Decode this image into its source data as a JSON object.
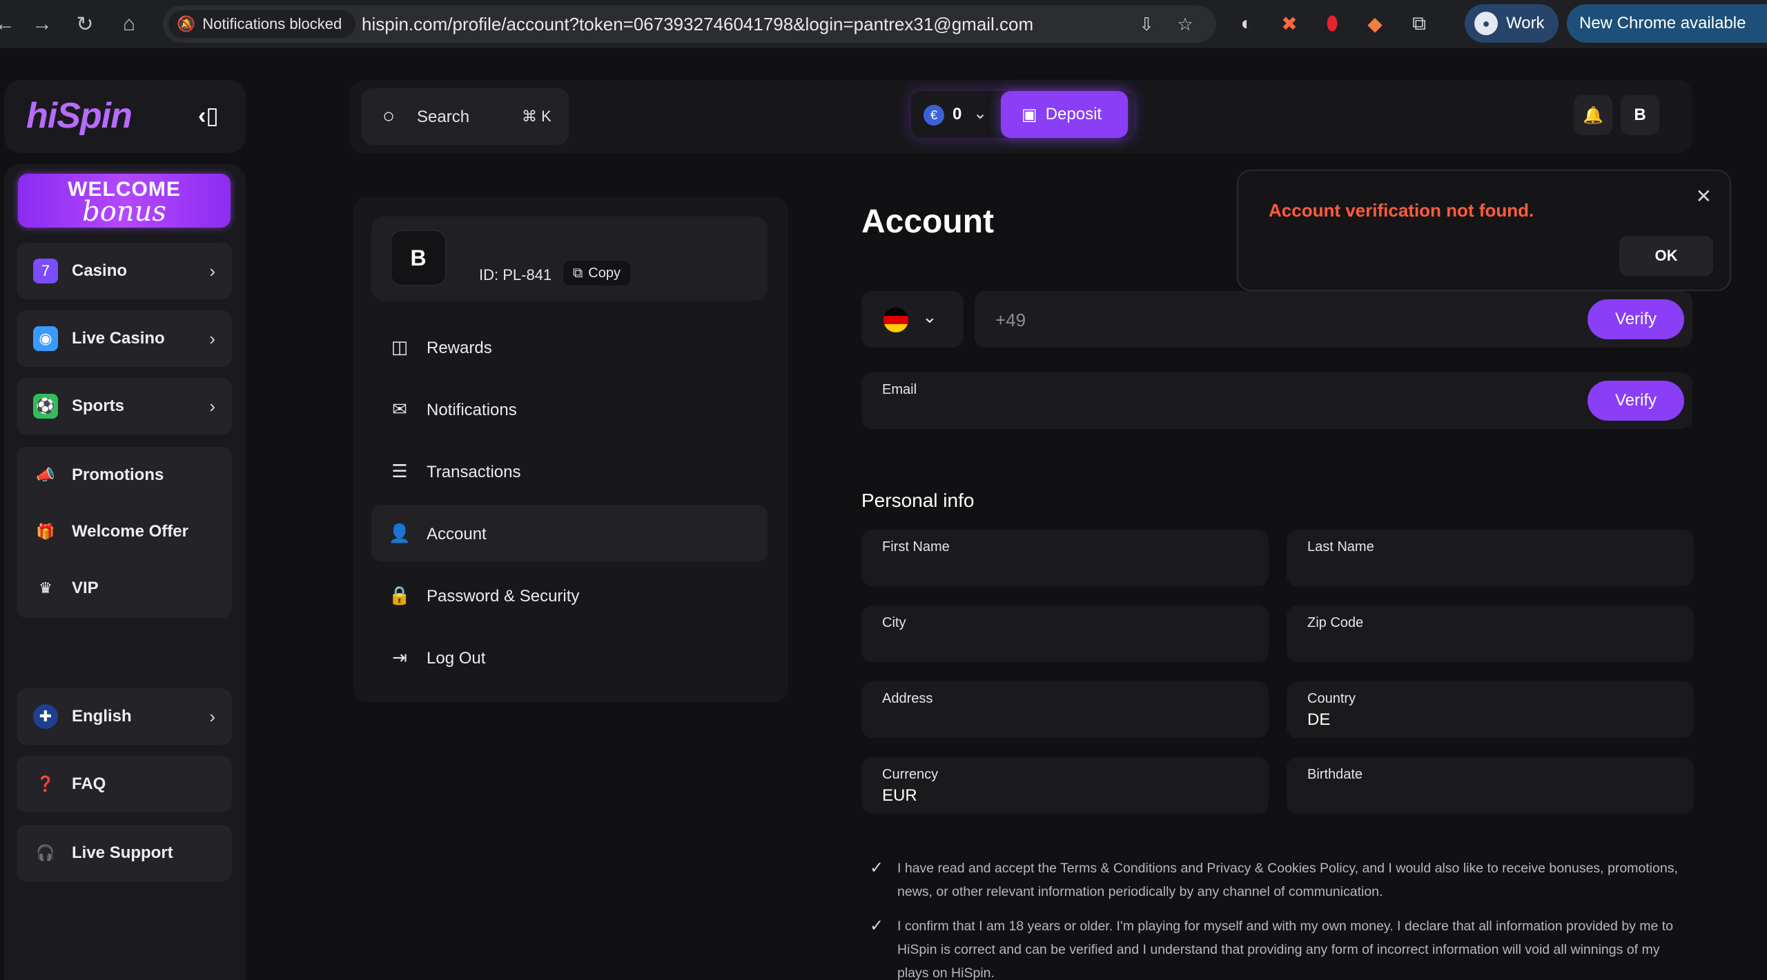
{
  "browser": {
    "omnibox_chip": "Notifications blocked",
    "url": "hispin.com/profile/account?token=0673932746041798&login=pantrex31@gmail.com",
    "profile_label": "Work",
    "update_label": "New Chrome available"
  },
  "sidebar": {
    "logo": "hiSpin",
    "welcome_line1": "WELCOME",
    "welcome_line2": "bonus",
    "items": [
      {
        "label": "Casino",
        "icon": "casino-icon",
        "color": "#7b4dff"
      },
      {
        "label": "Live Casino",
        "icon": "live-casino-icon",
        "color": "#3a9bff"
      },
      {
        "label": "Sports",
        "icon": "sports-icon",
        "color": "#2fbf5a"
      },
      {
        "label": "Promotions",
        "icon": "megaphone-icon"
      },
      {
        "label": "Welcome Offer",
        "icon": "gift-icon"
      },
      {
        "label": "VIP",
        "icon": "crown-icon"
      },
      {
        "label": "English",
        "icon": "uk-flag-icon"
      },
      {
        "label": "FAQ",
        "icon": "question-icon"
      },
      {
        "label": "Live Support",
        "icon": "headset-icon"
      }
    ]
  },
  "header": {
    "search_label": "Search",
    "search_shortcut": "⌘ K",
    "balance": "0",
    "currency_symbol": "€",
    "deposit_label": "Deposit",
    "avatar": "B"
  },
  "profile_menu": {
    "avatar": "B",
    "user_id": "ID: PL-841",
    "copy_label": "Copy",
    "items": [
      {
        "label": "Rewards"
      },
      {
        "label": "Notifications"
      },
      {
        "label": "Transactions"
      },
      {
        "label": "Account"
      },
      {
        "label": "Password & Security"
      },
      {
        "label": "Log Out"
      }
    ]
  },
  "account": {
    "title": "Account",
    "phone_value": "+49",
    "verify_label": "Verify",
    "email_label": "Email",
    "personal_info_title": "Personal info",
    "fields": {
      "first_name": {
        "label": "First Name",
        "value": ""
      },
      "last_name": {
        "label": "Last Name",
        "value": ""
      },
      "city": {
        "label": "City",
        "value": ""
      },
      "zip": {
        "label": "Zip Code",
        "value": ""
      },
      "address": {
        "label": "Address",
        "value": ""
      },
      "country": {
        "label": "Country",
        "value": "DE"
      },
      "currency": {
        "label": "Currency",
        "value": "EUR"
      },
      "birthdate": {
        "label": "Birthdate",
        "value": ""
      }
    },
    "consent_terms": "I have read and accept the Terms & Conditions and Privacy & Cookies Policy, and I would also like to receive bonuses, promotions, news, or other relevant information periodically by any channel of communication.",
    "consent_age": "I confirm that I am 18 years or older. I'm playing for myself and with my own money. I declare that all information provided by me to HiSpin is correct and can be verified and I understand that providing any form of incorrect information will void all winnings of my plays on HiSpin."
  },
  "toast": {
    "message": "Account verification not found.",
    "ok_label": "OK"
  },
  "colors": {
    "accent": "#8a3ef6",
    "error": "#ff5d3a",
    "background": "#111113"
  }
}
